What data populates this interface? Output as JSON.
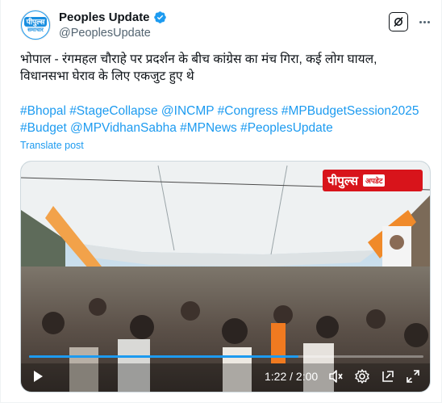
{
  "author": {
    "display_name": "Peoples Update",
    "handle": "@PeoplesUpdate",
    "avatar_text_top": "पीपुल्स",
    "avatar_text_bottom": "समाचार"
  },
  "tweet": {
    "line1": "भोपाल - रंगमहल चौराहे पर प्रदर्शन के बीच कांग्रेस का मंच गिरा, कई लोग घायल,",
    "line2": "विधानसभा घेराव के लिए एकजुट हुए थे",
    "hashtags_line1": "#Bhopal #StageCollapse @INCMP #Congress #MPBudgetSession2025",
    "hashtags_line2": "#Budget @MPVidhanSabha #MPNews #PeoplesUpdate",
    "translate_label": "Translate post"
  },
  "video": {
    "logo_main": "पीपुल्स",
    "logo_sub": "अपडेट",
    "current_time": "1:22",
    "duration": "2:00",
    "timecode": "1:22 / 2:00",
    "progress": 0.683
  },
  "icons": {
    "verified": "verified-badge-icon",
    "grok": "grok-icon",
    "more": "more-icon",
    "play": "play-icon",
    "volume": "volume-icon",
    "settings": "settings-gear-icon",
    "pip": "picture-in-picture-icon",
    "fullscreen": "fullscreen-icon"
  },
  "colors": {
    "accent": "#1d9bf0",
    "text": "#0f1419",
    "muted": "#536471",
    "logo_red": "#d8141b"
  }
}
